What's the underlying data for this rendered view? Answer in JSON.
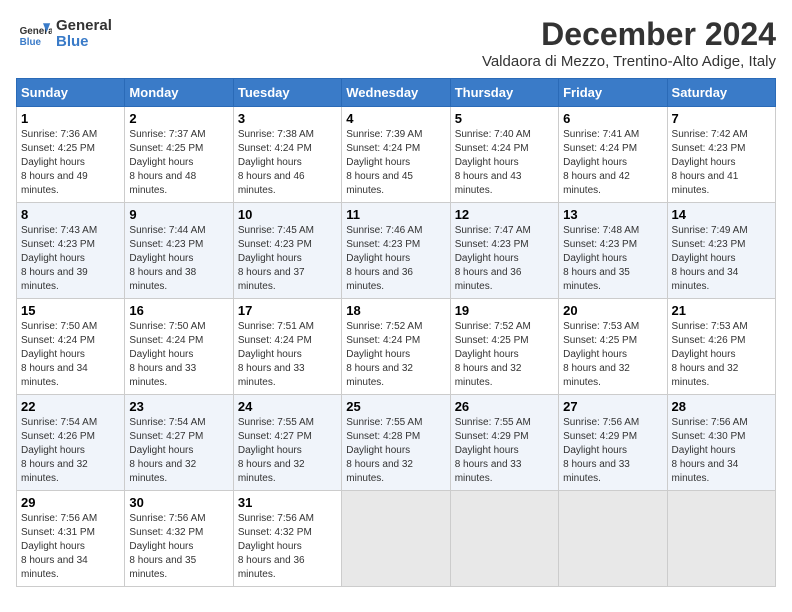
{
  "logo": {
    "line1": "General",
    "line2": "Blue"
  },
  "title": "December 2024",
  "subtitle": "Valdaora di Mezzo, Trentino-Alto Adige, Italy",
  "weekdays": [
    "Sunday",
    "Monday",
    "Tuesday",
    "Wednesday",
    "Thursday",
    "Friday",
    "Saturday"
  ],
  "weeks": [
    [
      {
        "day": "1",
        "sunrise": "7:36 AM",
        "sunset": "4:25 PM",
        "daylight": "8 hours and 49 minutes."
      },
      {
        "day": "2",
        "sunrise": "7:37 AM",
        "sunset": "4:25 PM",
        "daylight": "8 hours and 48 minutes."
      },
      {
        "day": "3",
        "sunrise": "7:38 AM",
        "sunset": "4:24 PM",
        "daylight": "8 hours and 46 minutes."
      },
      {
        "day": "4",
        "sunrise": "7:39 AM",
        "sunset": "4:24 PM",
        "daylight": "8 hours and 45 minutes."
      },
      {
        "day": "5",
        "sunrise": "7:40 AM",
        "sunset": "4:24 PM",
        "daylight": "8 hours and 43 minutes."
      },
      {
        "day": "6",
        "sunrise": "7:41 AM",
        "sunset": "4:24 PM",
        "daylight": "8 hours and 42 minutes."
      },
      {
        "day": "7",
        "sunrise": "7:42 AM",
        "sunset": "4:23 PM",
        "daylight": "8 hours and 41 minutes."
      }
    ],
    [
      {
        "day": "8",
        "sunrise": "7:43 AM",
        "sunset": "4:23 PM",
        "daylight": "8 hours and 39 minutes."
      },
      {
        "day": "9",
        "sunrise": "7:44 AM",
        "sunset": "4:23 PM",
        "daylight": "8 hours and 38 minutes."
      },
      {
        "day": "10",
        "sunrise": "7:45 AM",
        "sunset": "4:23 PM",
        "daylight": "8 hours and 37 minutes."
      },
      {
        "day": "11",
        "sunrise": "7:46 AM",
        "sunset": "4:23 PM",
        "daylight": "8 hours and 36 minutes."
      },
      {
        "day": "12",
        "sunrise": "7:47 AM",
        "sunset": "4:23 PM",
        "daylight": "8 hours and 36 minutes."
      },
      {
        "day": "13",
        "sunrise": "7:48 AM",
        "sunset": "4:23 PM",
        "daylight": "8 hours and 35 minutes."
      },
      {
        "day": "14",
        "sunrise": "7:49 AM",
        "sunset": "4:23 PM",
        "daylight": "8 hours and 34 minutes."
      }
    ],
    [
      {
        "day": "15",
        "sunrise": "7:50 AM",
        "sunset": "4:24 PM",
        "daylight": "8 hours and 34 minutes."
      },
      {
        "day": "16",
        "sunrise": "7:50 AM",
        "sunset": "4:24 PM",
        "daylight": "8 hours and 33 minutes."
      },
      {
        "day": "17",
        "sunrise": "7:51 AM",
        "sunset": "4:24 PM",
        "daylight": "8 hours and 33 minutes."
      },
      {
        "day": "18",
        "sunrise": "7:52 AM",
        "sunset": "4:24 PM",
        "daylight": "8 hours and 32 minutes."
      },
      {
        "day": "19",
        "sunrise": "7:52 AM",
        "sunset": "4:25 PM",
        "daylight": "8 hours and 32 minutes."
      },
      {
        "day": "20",
        "sunrise": "7:53 AM",
        "sunset": "4:25 PM",
        "daylight": "8 hours and 32 minutes."
      },
      {
        "day": "21",
        "sunrise": "7:53 AM",
        "sunset": "4:26 PM",
        "daylight": "8 hours and 32 minutes."
      }
    ],
    [
      {
        "day": "22",
        "sunrise": "7:54 AM",
        "sunset": "4:26 PM",
        "daylight": "8 hours and 32 minutes."
      },
      {
        "day": "23",
        "sunrise": "7:54 AM",
        "sunset": "4:27 PM",
        "daylight": "8 hours and 32 minutes."
      },
      {
        "day": "24",
        "sunrise": "7:55 AM",
        "sunset": "4:27 PM",
        "daylight": "8 hours and 32 minutes."
      },
      {
        "day": "25",
        "sunrise": "7:55 AM",
        "sunset": "4:28 PM",
        "daylight": "8 hours and 32 minutes."
      },
      {
        "day": "26",
        "sunrise": "7:55 AM",
        "sunset": "4:29 PM",
        "daylight": "8 hours and 33 minutes."
      },
      {
        "day": "27",
        "sunrise": "7:56 AM",
        "sunset": "4:29 PM",
        "daylight": "8 hours and 33 minutes."
      },
      {
        "day": "28",
        "sunrise": "7:56 AM",
        "sunset": "4:30 PM",
        "daylight": "8 hours and 34 minutes."
      }
    ],
    [
      {
        "day": "29",
        "sunrise": "7:56 AM",
        "sunset": "4:31 PM",
        "daylight": "8 hours and 34 minutes."
      },
      {
        "day": "30",
        "sunrise": "7:56 AM",
        "sunset": "4:32 PM",
        "daylight": "8 hours and 35 minutes."
      },
      {
        "day": "31",
        "sunrise": "7:56 AM",
        "sunset": "4:32 PM",
        "daylight": "8 hours and 36 minutes."
      },
      null,
      null,
      null,
      null
    ]
  ]
}
